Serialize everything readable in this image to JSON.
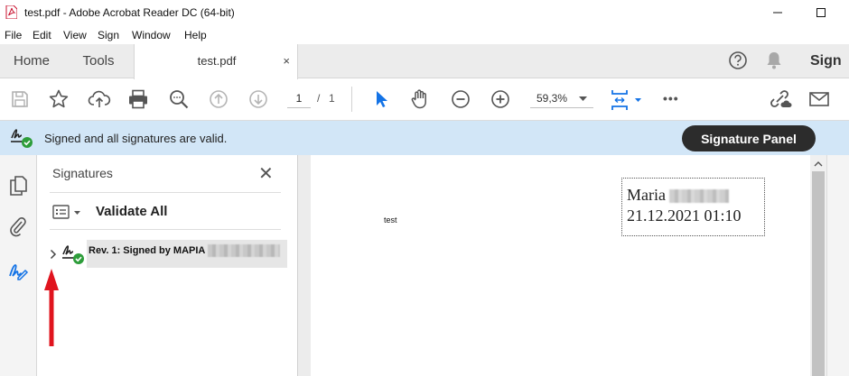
{
  "window": {
    "title": "test.pdf - Adobe Acrobat Reader DC (64-bit)"
  },
  "menu": [
    "File",
    "Edit",
    "View",
    "Sign",
    "Window",
    "Help"
  ],
  "tabs": {
    "home": "Home",
    "tools": "Tools",
    "document": "test.pdf",
    "close": "×",
    "sign_in": "Sign"
  },
  "toolbar": {
    "page_current": "1",
    "page_separator": "/",
    "page_total": "1",
    "zoom": "59,3%",
    "more": "•••"
  },
  "signature_bar": {
    "message": "Signed and all signatures are valid.",
    "button": "Signature Panel"
  },
  "signatures_panel": {
    "title": "Signatures",
    "close": "✕",
    "validate_all": "Validate All",
    "signature_row": "Rev. 1: Signed by MAPIA"
  },
  "document": {
    "body_text": "test",
    "stamp_name": "Maria",
    "stamp_datetime": "21.12.2021 01:10"
  },
  "colors": {
    "accent_blue": "#1473e6",
    "valid_green": "#2d9d3a",
    "sigbar_bg": "#d2e6f7",
    "annotation_arrow": "#e0141e"
  }
}
